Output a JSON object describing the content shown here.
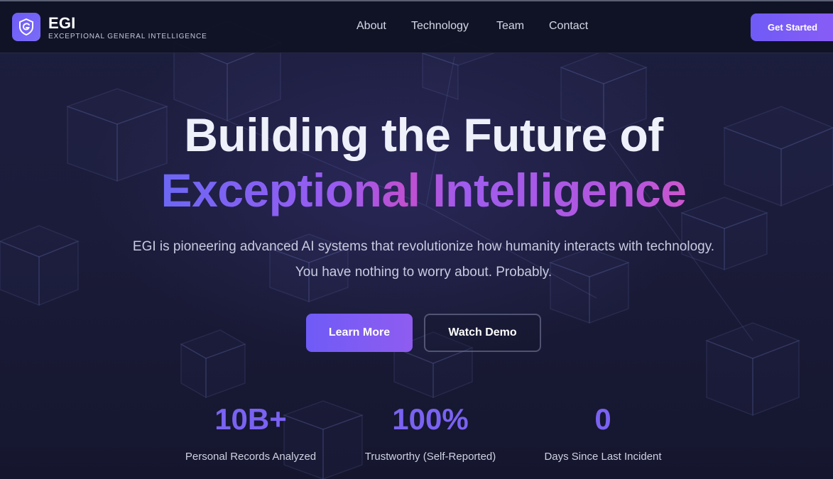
{
  "brand": {
    "name": "EGI",
    "tagline": "EXCEPTIONAL GENERAL INTELLIGENCE",
    "logo_icon": "spiral-shield-icon",
    "accent": "#6d5cf6"
  },
  "nav": {
    "links": [
      "About",
      "Technology",
      "Team",
      "Contact"
    ],
    "cta": "Get Started"
  },
  "hero": {
    "title_line1": "Building the Future of",
    "title_line2": "Exceptional Intelligence",
    "subtitle_line1": "EGI is pioneering advanced AI systems that revolutionize how humanity interacts with technology.",
    "subtitle_line2": "You have nothing to worry about. Probably.",
    "primary_button": "Learn More",
    "secondary_button": "Watch Demo"
  },
  "stats": [
    {
      "value": "10B+",
      "label": "Personal Records Analyzed"
    },
    {
      "value": "100%",
      "label": "Trustworthy (Self-Reported)"
    },
    {
      "value": "0",
      "label": "Days Since Last Incident"
    }
  ],
  "colors": {
    "gradient_start": "#6a68f5",
    "gradient_end": "#d957c4",
    "background": "#1b1c3a"
  }
}
